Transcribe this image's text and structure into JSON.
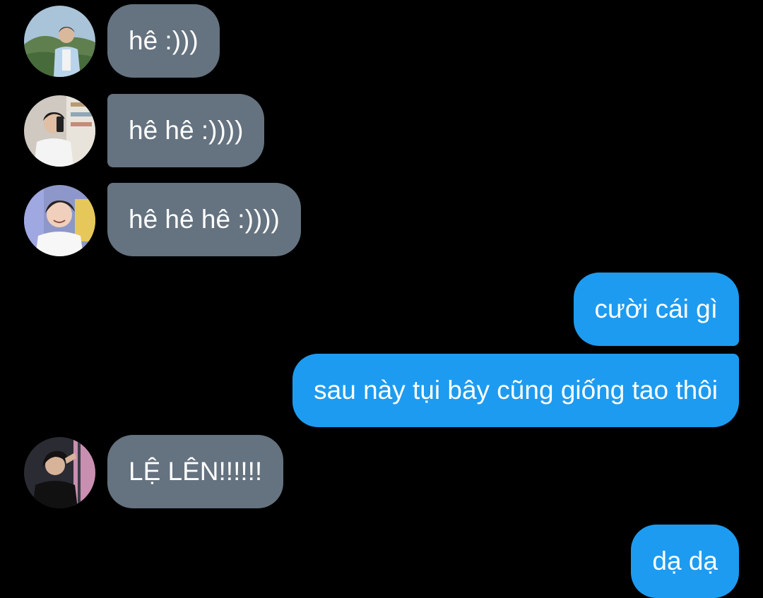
{
  "messages": [
    {
      "sender": "avatar-1",
      "direction": "incoming",
      "text": "hê :)))"
    },
    {
      "sender": "avatar-2",
      "direction": "incoming",
      "text": "hê hê :))))"
    },
    {
      "sender": "avatar-3",
      "direction": "incoming",
      "text": "hê hê hê :))))"
    },
    {
      "sender": "me",
      "direction": "outgoing",
      "text": "cười cái gì"
    },
    {
      "sender": "me",
      "direction": "outgoing",
      "text": "sau này tụi bây cũng giống tao thôi"
    },
    {
      "sender": "avatar-4",
      "direction": "incoming",
      "text": "LỆ LÊN!!!!!!"
    },
    {
      "sender": "me",
      "direction": "outgoing",
      "text": "dạ dạ"
    }
  ],
  "colors": {
    "background": "#000000",
    "incoming_bubble": "#65727f",
    "outgoing_bubble": "#1d9bf0",
    "bubble_text": "#ffffff"
  }
}
